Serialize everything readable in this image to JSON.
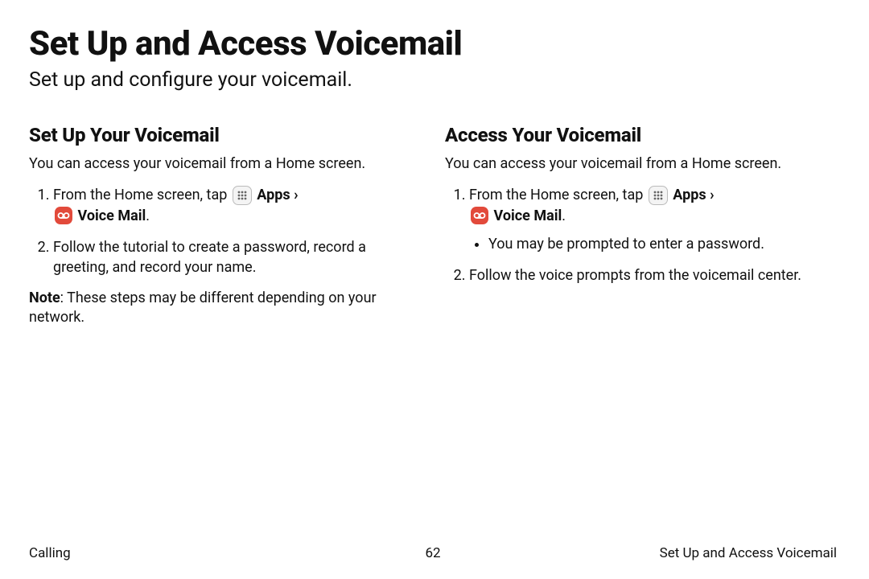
{
  "title": "Set Up and Access Voicemail",
  "subtitle": "Set up and configure your voicemail.",
  "left": {
    "heading": "Set Up Your Voicemail",
    "intro": "You can access your voicemail from a Home screen.",
    "step1_a": "From the Home screen, tap ",
    "apps_label": "Apps",
    "chev": " › ",
    "voicemail_label": "Voice Mail",
    "step2": "Follow the tutorial to create a password, record a greeting, and record your name.",
    "note_label": "Note",
    "note_text": ": These steps may be different depending on your network."
  },
  "right": {
    "heading": "Access Your Voicemail",
    "intro": "You can access your voicemail from a Home screen.",
    "step1_a": "From the Home screen, tap ",
    "apps_label": "Apps",
    "chev": " › ",
    "voicemail_label": "Voice Mail",
    "bullet1": "You may be prompted to enter a password.",
    "step2": "Follow the voice prompts from the voicemail center."
  },
  "footer": {
    "left": "Calling",
    "page": "62",
    "right": "Set Up and Access Voicemail"
  }
}
